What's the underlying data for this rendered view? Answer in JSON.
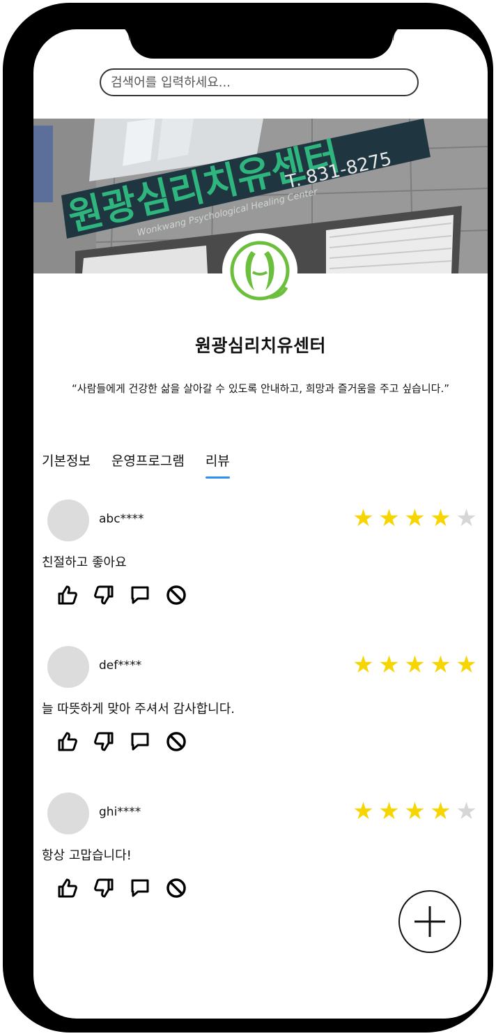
{
  "search": {
    "placeholder": "검색어를 입력하세요..."
  },
  "banner": {
    "sign_text": "원광심리치유센터",
    "sign_english": "Wonkwang Psychological Healing Center",
    "sign_phone": "T. 831-8275"
  },
  "center": {
    "name": "원광심리치유센터",
    "motto": "“사람들에게 건강한 삶을 살아갈 수 있도록 안내하고, 희망과 즐거움을 주고 싶습니다.”"
  },
  "tabs": [
    {
      "label": "기본정보",
      "active": false
    },
    {
      "label": "운영프로그램",
      "active": false
    },
    {
      "label": "리뷰",
      "active": true
    }
  ],
  "reviews": [
    {
      "user": "abc****",
      "rating": 4,
      "max_rating": 5,
      "content": "친절하고 좋아요"
    },
    {
      "user": "def****",
      "rating": 5,
      "max_rating": 5,
      "content": "늘 따뜻하게 맞아 주셔서 감사합니다."
    },
    {
      "user": "ghi****",
      "rating": 4,
      "max_rating": 5,
      "content": "항상 고맙습니다!"
    }
  ],
  "review_actions": [
    "thumbs-up-icon",
    "thumbs-down-icon",
    "comment-icon",
    "block-icon"
  ],
  "fab": {
    "icon": "plus-icon"
  },
  "colors": {
    "accent": "#2f8ff0",
    "star_on": "#f7d500",
    "star_off": "#d6d6d6",
    "logo_green": "#6cbf3c",
    "sign_text_green": "#2fb67f",
    "sign_panel": "#1f3640"
  }
}
